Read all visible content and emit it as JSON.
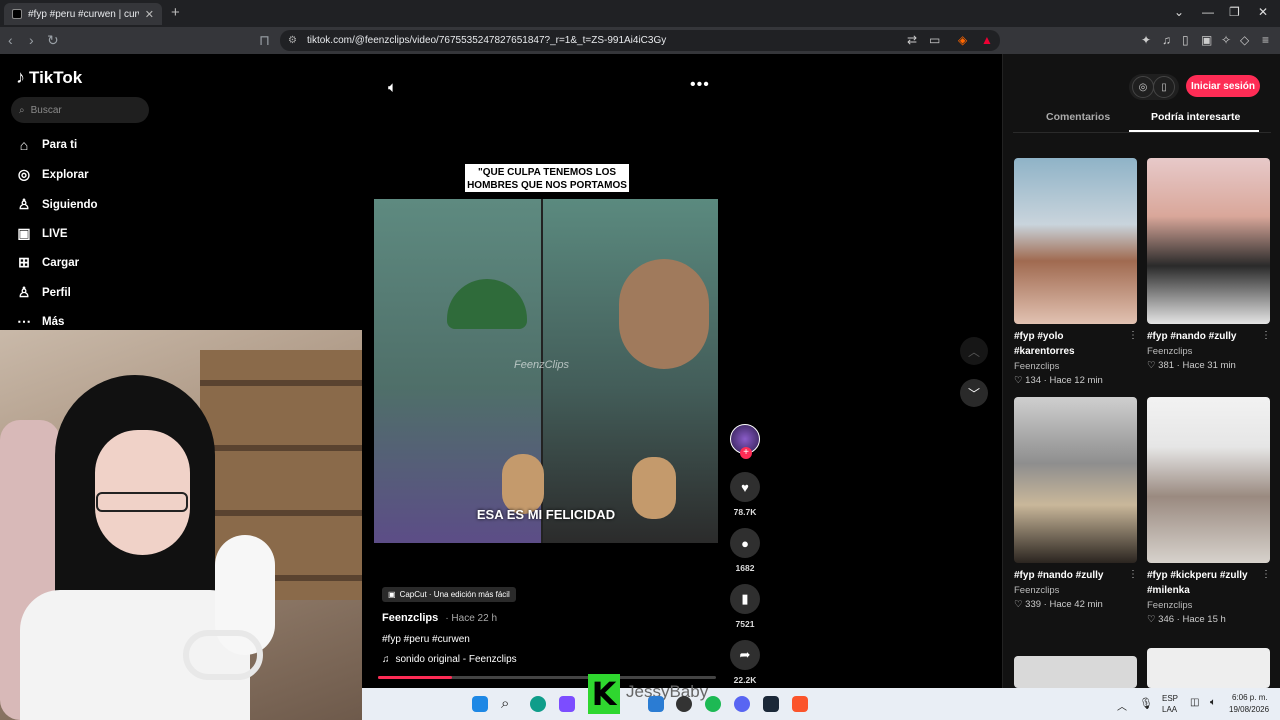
{
  "browser": {
    "tab_title": "#fyp #peru #curwen | curwen",
    "url": "tiktok.com/@feenzclips/video/7675535247827651847?_r=1&_t=ZS-991Ai4iC3Gy"
  },
  "sidebar": {
    "brand": "TikTok",
    "search_placeholder": "Buscar",
    "items": [
      {
        "label": "Para ti"
      },
      {
        "label": "Explorar"
      },
      {
        "label": "Siguiendo"
      },
      {
        "label": "LIVE"
      },
      {
        "label": "Cargar"
      },
      {
        "label": "Perfil"
      },
      {
        "label": "Más"
      }
    ]
  },
  "video": {
    "caption_text": "\"QUE CULPA TENEMOS LOS HOMBRES QUE NOS PORTAMOS BIEN\"",
    "subtitle": "ESA ES MI FELICIDAD",
    "watermark": "FeenzClips",
    "capcut_label": "CapCut · Una edición más fácil",
    "author": "Feenzclips",
    "posted": "· Hace 22 h",
    "hashtags": "#fyp #peru #curwen",
    "sound": "sonido original - Feenzclips",
    "progress": 0.22,
    "likes": "78.7K",
    "comments": "1682",
    "saves": "7521",
    "shares": "22.2K"
  },
  "right_panel": {
    "login_label": "Iniciar sesión",
    "tabs": [
      "Comentarios",
      "Podría interesarte"
    ],
    "cards": [
      {
        "title": "#fyp #yolo #karentorres",
        "author": "Feenzclips",
        "likes": "134",
        "time": "Hace 12 min"
      },
      {
        "title": "#fyp #nando #zully",
        "author": "Feenzclips",
        "likes": "381",
        "time": "Hace 31 min"
      },
      {
        "title": "#fyp #nando #zully",
        "author": "Feenzclips",
        "likes": "339",
        "time": "Hace 42 min"
      },
      {
        "title": "#fyp #kickperu #zully #milenka",
        "author": "Feenzclips",
        "likes": "346",
        "time": "Hace 15 h"
      }
    ]
  },
  "taskbar": {
    "overlay_name": "JessyBaby",
    "lang": "ESP",
    "lang_sub": "LAA",
    "time": "6:06 p. m.",
    "date": "19/08/2026"
  },
  "colors": {
    "accent": "#fe2c55",
    "background": "#000000",
    "panel": "#121212"
  }
}
